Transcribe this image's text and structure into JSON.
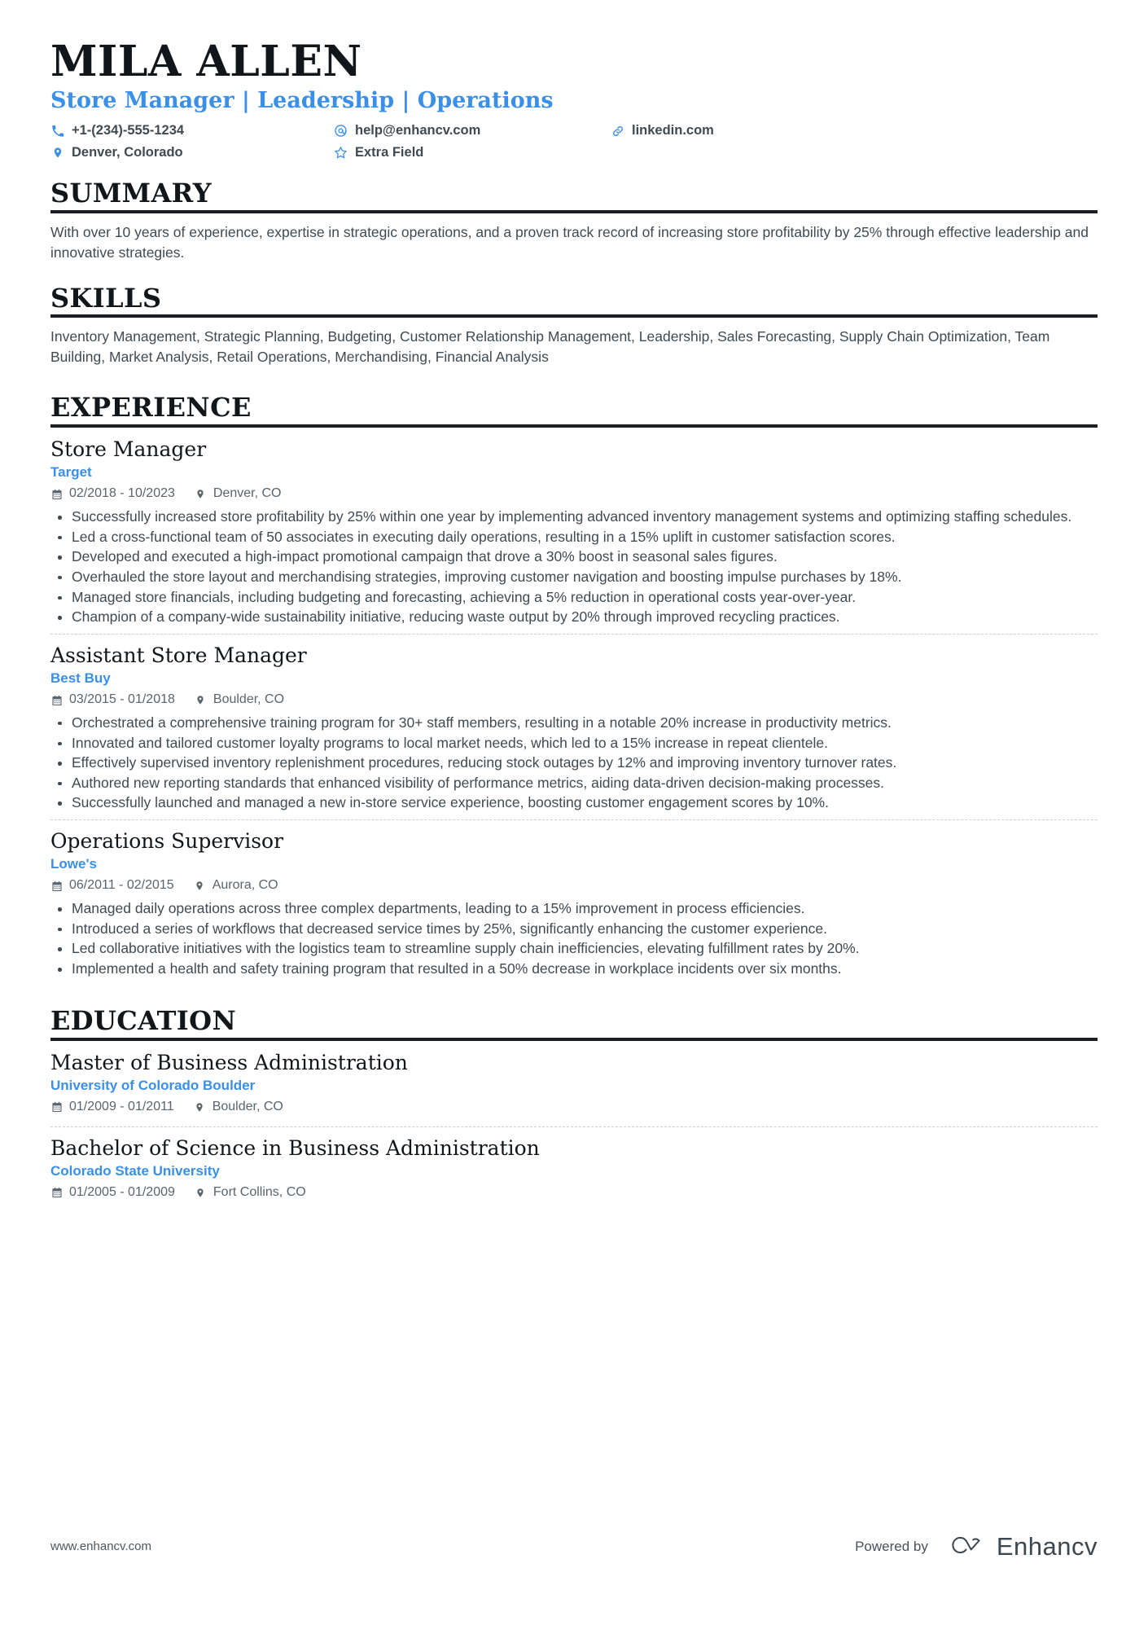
{
  "header": {
    "name": "MILA ALLEN",
    "headline": "Store Manager | Leadership | Operations",
    "contacts": [
      {
        "icon": "phone-icon",
        "text": "+1-(234)-555-1234"
      },
      {
        "icon": "email-icon",
        "text": "help@enhancv.com"
      },
      {
        "icon": "link-icon",
        "text": "linkedin.com"
      },
      {
        "icon": "location-pin-icon",
        "text": "Denver, Colorado"
      },
      {
        "icon": "star-icon",
        "text": "Extra Field"
      }
    ]
  },
  "sections": {
    "summary": {
      "title": "SUMMARY",
      "text": "With over 10 years of experience, expertise in strategic operations, and a proven track record of increasing store profitability by 25% through effective leadership and innovative strategies."
    },
    "skills": {
      "title": "SKILLS",
      "text": "Inventory Management, Strategic Planning, Budgeting, Customer Relationship Management, Leadership, Sales Forecasting, Supply Chain Optimization, Team Building, Market Analysis, Retail Operations, Merchandising, Financial Analysis"
    },
    "experience": {
      "title": "EXPERIENCE",
      "entries": [
        {
          "title": "Store Manager",
          "org": "Target",
          "dates": "02/2018 - 10/2023",
          "location": "Denver, CO",
          "bullets": [
            "Successfully increased store profitability by 25% within one year by implementing advanced inventory management systems and optimizing staffing schedules.",
            "Led a cross-functional team of 50 associates in executing daily operations, resulting in a 15% uplift in customer satisfaction scores.",
            "Developed and executed a high-impact promotional campaign that drove a 30% boost in seasonal sales figures.",
            "Overhauled the store layout and merchandising strategies, improving customer navigation and boosting impulse purchases by 18%.",
            "Managed store financials, including budgeting and forecasting, achieving a 5% reduction in operational costs year-over-year.",
            "Champion of a company-wide sustainability initiative, reducing waste output by 20% through improved recycling practices."
          ]
        },
        {
          "title": "Assistant Store Manager",
          "org": "Best Buy",
          "dates": "03/2015 - 01/2018",
          "location": "Boulder, CO",
          "bullets": [
            "Orchestrated a comprehensive training program for 30+ staff members, resulting in a notable 20% increase in productivity metrics.",
            "Innovated and tailored customer loyalty programs to local market needs, which led to a 15% increase in repeat clientele.",
            "Effectively supervised inventory replenishment procedures, reducing stock outages by 12% and improving inventory turnover rates.",
            "Authored new reporting standards that enhanced visibility of performance metrics, aiding data-driven decision-making processes.",
            "Successfully launched and managed a new in-store service experience, boosting customer engagement scores by 10%."
          ]
        },
        {
          "title": "Operations Supervisor",
          "org": "Lowe's",
          "dates": "06/2011 - 02/2015",
          "location": "Aurora, CO",
          "bullets": [
            "Managed daily operations across three complex departments, leading to a 15% improvement in process efficiencies.",
            "Introduced a series of workflows that decreased service times by 25%, significantly enhancing the customer experience.",
            "Led collaborative initiatives with the logistics team to streamline supply chain inefficiencies, elevating fulfillment rates by 20%.",
            "Implemented a health and safety training program that resulted in a 50% decrease in workplace incidents over six months."
          ]
        }
      ]
    },
    "education": {
      "title": "EDUCATION",
      "entries": [
        {
          "title": "Master of Business Administration",
          "org": "University of Colorado Boulder",
          "dates": "01/2009 - 01/2011",
          "location": "Boulder, CO"
        },
        {
          "title": "Bachelor of Science in Business Administration",
          "org": "Colorado State University",
          "dates": "01/2005 - 01/2009",
          "location": "Fort Collins, CO"
        }
      ]
    }
  },
  "footer": {
    "url": "www.enhancv.com",
    "powered_by": "Powered by",
    "brand": "Enhancv"
  },
  "colors": {
    "accent_blue": "#3a8fe8",
    "heading_black": "#11161a",
    "body_gray": "#3f4a52",
    "meta_gray": "#5a646c"
  }
}
